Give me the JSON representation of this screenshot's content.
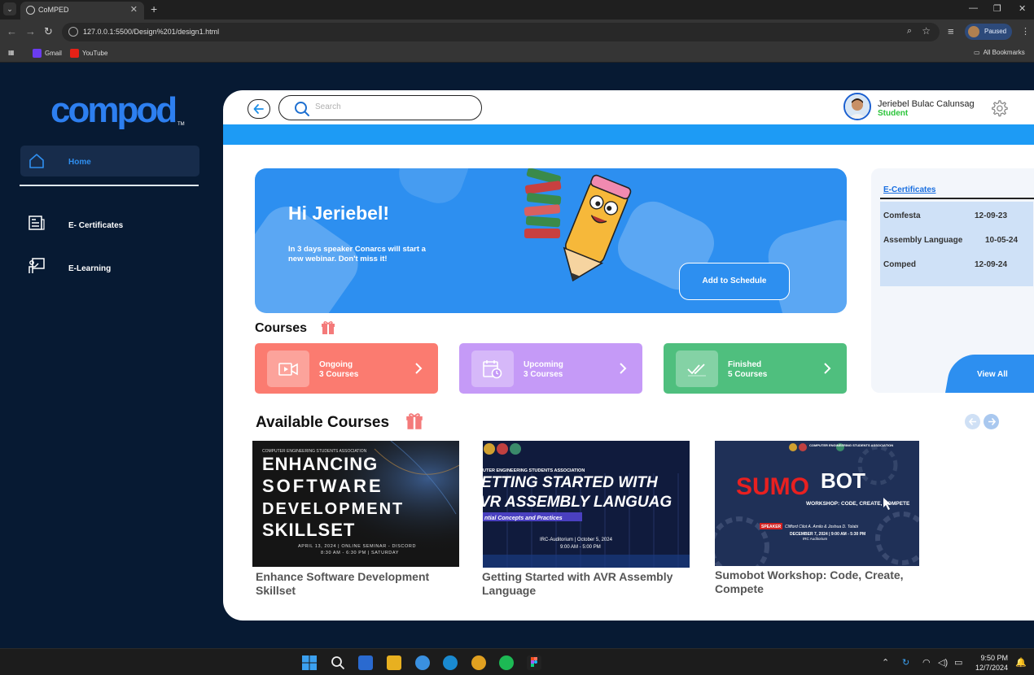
{
  "browser": {
    "tab_title": "CoMPED",
    "url": "127.0.0.1:5500/Design%201/design1.html",
    "profile_status": "Paused",
    "bookmarks": [
      {
        "label": "Gmail",
        "color": "#6a3cf0"
      },
      {
        "label": "YouTube",
        "color": "#e62117"
      }
    ],
    "all_bookmarks": "All Bookmarks"
  },
  "sidebar": {
    "logo_text": "compod",
    "items": [
      {
        "label": "Home",
        "icon": "home-icon",
        "active": true
      },
      {
        "label": "E- Certificates",
        "icon": "certificate-icon"
      },
      {
        "label": "E-Learning",
        "icon": "e-learning-icon"
      }
    ]
  },
  "header": {
    "search_placeholder": "Search",
    "user_name": "Jeriebel Bulac Calunsag",
    "user_role": "Student"
  },
  "hero": {
    "greeting": "Hi Jeriebel!",
    "message": "In 3 days speaker Conarcs will start a new webinar. Don't miss it!",
    "button_label": "Add to Schedule"
  },
  "certificates": {
    "title": "E-Certificates",
    "rows": [
      {
        "name": "Comfesta",
        "date": "12-09-23"
      },
      {
        "name": "Assembly Language",
        "date": "10-05-24"
      },
      {
        "name": "Comped",
        "date": "12-09-24"
      }
    ],
    "view_all": "View All"
  },
  "courses": {
    "title": "Courses",
    "cards": [
      {
        "name": "Ongoing",
        "count": "3 Courses",
        "color": "#fb7b70",
        "icon": "video-icon"
      },
      {
        "name": "Upcoming",
        "count": "3 Courses",
        "color": "#c59af7",
        "icon": "calendar-clock-icon"
      },
      {
        "name": "Finished",
        "count": "5 Courses",
        "color": "#4fbf7e",
        "icon": "double-check-icon"
      }
    ]
  },
  "available": {
    "title": "Available Courses",
    "items": [
      {
        "caption": "Enhance Software Development Skillset",
        "poster_org": "COMPUTER ENGINEERING STUDENTS ASSOCIATION",
        "poster_lines": [
          "ENHANCING",
          "SOFTWARE",
          "DEVELOPMENT",
          "SKILLSET"
        ],
        "poster_info_1": "APRIL 13, 2024 | ONLINE SEMINAR - DISCORD",
        "poster_info_2": "8:30 AM - 6:30 PM | SATURDAY"
      },
      {
        "caption": "Getting Started with AVR Assembly Language",
        "poster_org": "UTER ENGINEERING STUDENTS ASSOCIATION",
        "poster_lines": [
          "ETTING STARTED WITH",
          "VR ASSEMBLY LANGUAG"
        ],
        "poster_sub": "ntial Concepts and Practices",
        "poster_info_1": "IRC-Auditorium | October 5, 2024",
        "poster_info_2": "9:00 AM - 5:00 PM"
      },
      {
        "caption": "Sumobot Workshop: Code, Create, Compete",
        "poster_org": "COMPUTER ENGINEERING STUDENTS ASSOCIATION",
        "poster_title_a": "SUMO",
        "poster_title_b": "BOT",
        "poster_sub": "WORKSHOP: CODE, CREATE, COMPETE",
        "poster_speaker_tag": "SPEAKER",
        "poster_speakers": "Clifford Cilot A. Amilo & Joshua D. Tolabi",
        "poster_info_1": "DECEMBER 7, 2024 | 9:00 AM - 5:30 PM",
        "poster_info_2": "IRC Auditorium"
      }
    ]
  },
  "taskbar": {
    "time": "9:50 PM",
    "date": "12/7/2024"
  }
}
